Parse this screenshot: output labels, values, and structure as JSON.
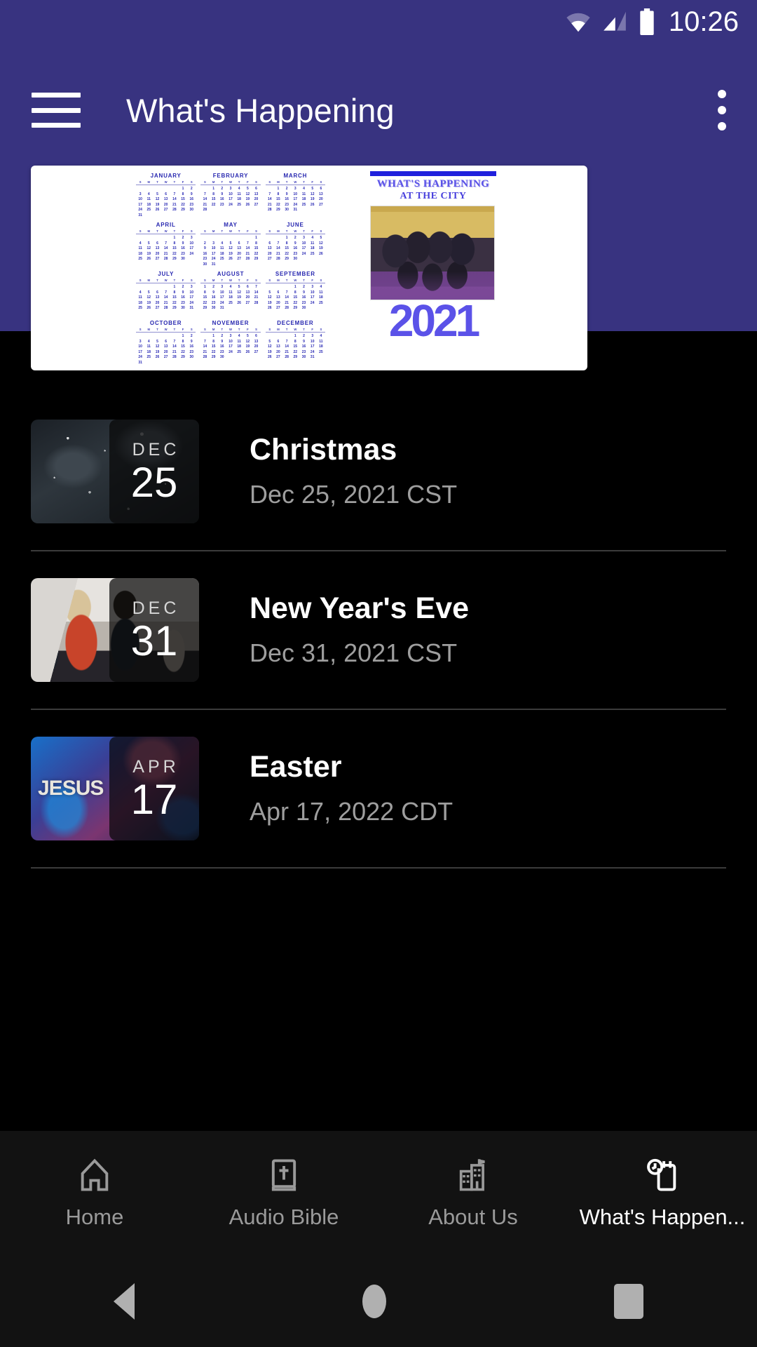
{
  "status_bar": {
    "time": "10:26",
    "icons": [
      "wifi-icon",
      "cellular-signal-icon",
      "battery-icon"
    ]
  },
  "app_bar": {
    "title": "What's Happening",
    "menu_icon": "hamburger-menu-icon",
    "overflow_icon": "overflow-menu-icon",
    "background_color": "#383380"
  },
  "banner": {
    "headline_line1": "WHAT'S HAPPENING",
    "headline_line2": "AT THE CITY",
    "year": "2021",
    "accent_color": "#5b52e8",
    "months": [
      {
        "name": "JANUARY",
        "start": 5,
        "days": 31
      },
      {
        "name": "FEBRUARY",
        "start": 1,
        "days": 28
      },
      {
        "name": "MARCH",
        "start": 1,
        "days": 31
      },
      {
        "name": "APRIL",
        "start": 4,
        "days": 30
      },
      {
        "name": "MAY",
        "start": 6,
        "days": 31
      },
      {
        "name": "JUNE",
        "start": 2,
        "days": 30
      },
      {
        "name": "JULY",
        "start": 4,
        "days": 31
      },
      {
        "name": "AUGUST",
        "start": 0,
        "days": 31
      },
      {
        "name": "SEPTEMBER",
        "start": 3,
        "days": 30
      },
      {
        "name": "OCTOBER",
        "start": 5,
        "days": 31
      },
      {
        "name": "NOVEMBER",
        "start": 1,
        "days": 30
      },
      {
        "name": "DECEMBER",
        "start": 3,
        "days": 31
      }
    ],
    "day_initials": [
      "S",
      "M",
      "T",
      "W",
      "T",
      "F",
      "S"
    ]
  },
  "events": [
    {
      "title": "Christmas",
      "date_text": "Dec 25, 2021 CST",
      "chip_month": "DEC",
      "chip_day": "25",
      "thumb_style": "snow",
      "thumb_text": ""
    },
    {
      "title": "New Year's Eve",
      "date_text": "Dec 31, 2021 CST",
      "chip_month": "DEC",
      "chip_day": "31",
      "thumb_style": "party",
      "thumb_text": ""
    },
    {
      "title": "Easter",
      "date_text": "Apr 17, 2022 CDT",
      "chip_month": "APR",
      "chip_day": "17",
      "thumb_style": "jesus",
      "thumb_text": "JESUS"
    }
  ],
  "tab_bar": {
    "active_index": 3,
    "tabs": [
      {
        "label": "Home",
        "icon": "home-church-icon"
      },
      {
        "label": "Audio Bible",
        "icon": "bible-book-icon"
      },
      {
        "label": "About Us",
        "icon": "building-city-icon"
      },
      {
        "label": "What's Happen...",
        "icon": "calendar-clock-icon"
      }
    ]
  },
  "system_nav": {
    "back": "back-triangle-icon",
    "home": "home-circle-icon",
    "recents": "recents-square-icon"
  }
}
